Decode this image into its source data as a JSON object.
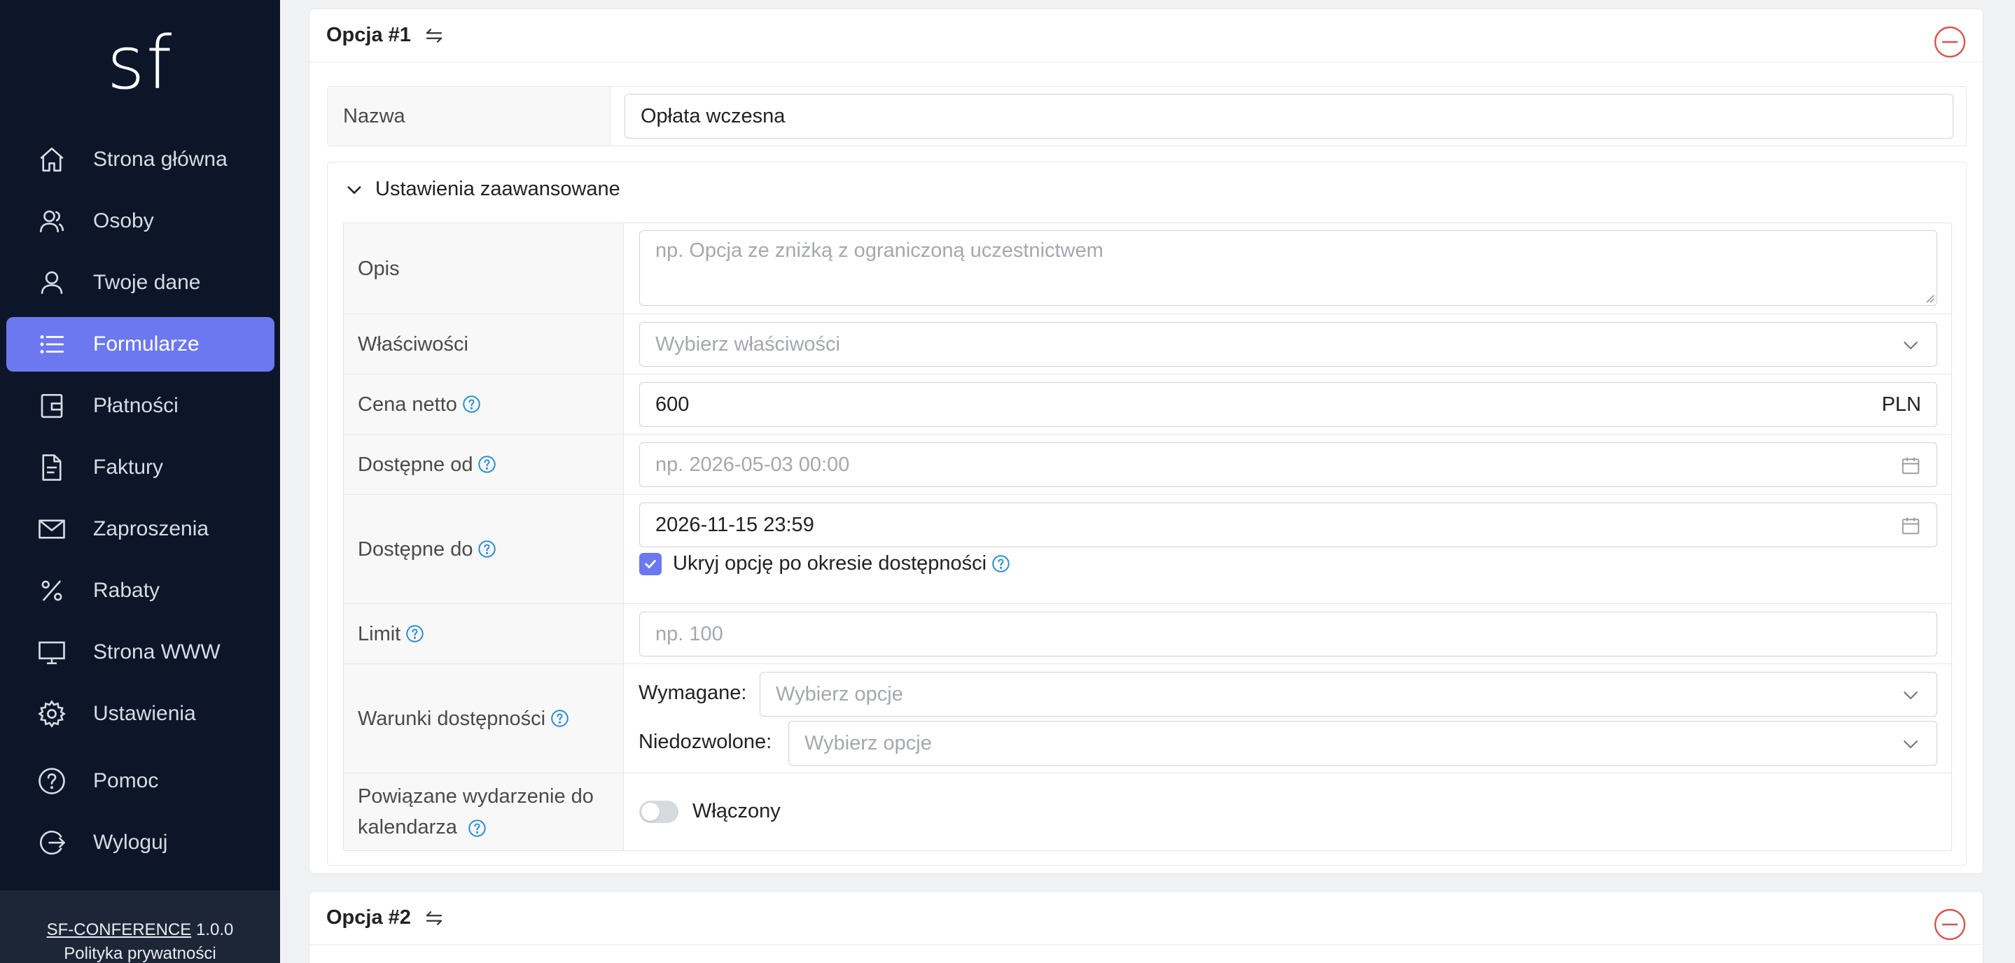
{
  "sidebar": {
    "logo": "sf",
    "items": [
      {
        "label": "Strona główna",
        "icon": "home-icon"
      },
      {
        "label": "Osoby",
        "icon": "users-icon"
      },
      {
        "label": "Twoje dane",
        "icon": "user-icon"
      },
      {
        "label": "Formularze",
        "icon": "list-icon",
        "active": true
      },
      {
        "label": "Płatności",
        "icon": "wallet-icon"
      },
      {
        "label": "Faktury",
        "icon": "document-icon"
      },
      {
        "label": "Zaproszenia",
        "icon": "envelope-icon"
      },
      {
        "label": "Rabaty",
        "icon": "percent-icon"
      },
      {
        "label": "Strona WWW",
        "icon": "monitor-icon"
      },
      {
        "label": "Ustawienia",
        "icon": "gear-icon"
      },
      {
        "label": "Pomoc",
        "icon": "help-icon"
      },
      {
        "label": "Wyloguj",
        "icon": "logout-icon"
      }
    ],
    "footer": {
      "app_name": "SF-CONFERENCE",
      "version": "1.0.0",
      "privacy": "Polityka prywatności"
    }
  },
  "option1": {
    "title": "Opcja #1",
    "name_label": "Nazwa",
    "name_value": "Opłata wczesna",
    "advanced_label": "Ustawienia zaawansowane",
    "fields": {
      "opis_label": "Opis",
      "opis_placeholder": "np. Opcja ze zniżką z ograniczoną uczestnictwem",
      "wlasciwosci_label": "Właściwości",
      "wlasciwosci_placeholder": "Wybierz właściwości",
      "cena_label": "Cena netto",
      "cena_value": "600",
      "cena_currency": "PLN",
      "od_label": "Dostępne od",
      "od_placeholder": "np. 2026-05-03 00:00",
      "do_label": "Dostępne do",
      "do_value": "2026-11-15 23:59",
      "hide_label": "Ukryj opcję po okresie dostępności",
      "hide_checked": true,
      "limit_label": "Limit",
      "limit_placeholder": "np. 100",
      "warunki_label": "Warunki dostępności",
      "wymagane_label": "Wymagane:",
      "wymagane_placeholder": "Wybierz opcje",
      "niedozwolone_label": "Niedozwolone:",
      "niedozwolone_placeholder": "Wybierz opcje",
      "calendar_label_1": "Powiązane wydarzenie do",
      "calendar_label_2": "kalendarza",
      "calendar_toggle_label": "Włączony",
      "calendar_enabled": false
    }
  },
  "option2": {
    "title": "Opcja #2"
  },
  "colors": {
    "sidebar_bg": "#0c1628",
    "accent": "#6c78f0",
    "danger": "#d9534f",
    "help": "#2a8fd0"
  }
}
